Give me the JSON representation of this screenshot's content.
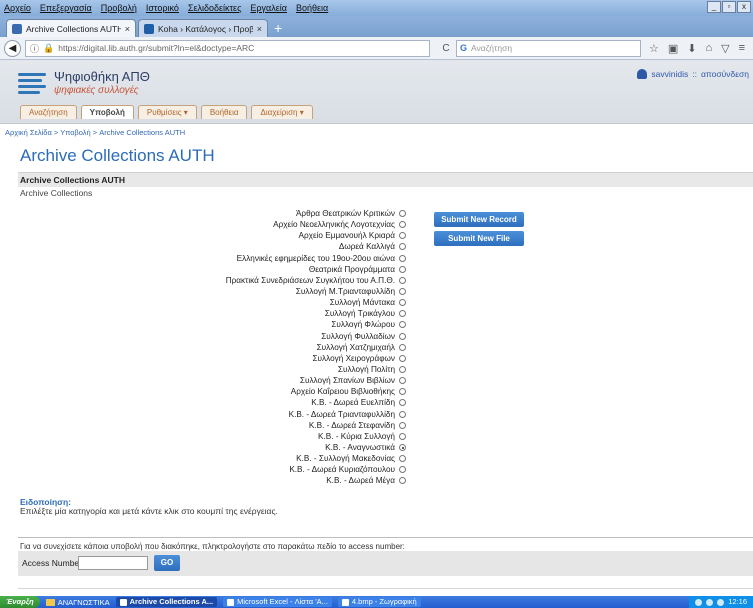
{
  "browser": {
    "menu": [
      "Αρχείο",
      "Επεξεργασία",
      "Προβολή",
      "Ιστορικό",
      "Σελιδοδείκτες",
      "Εργαλεία",
      "Βοήθεια"
    ],
    "window_buttons": [
      "_",
      "▫",
      "x"
    ],
    "tabs": [
      {
        "label": "Archive Collections AUTH - Αρ...",
        "close": "×"
      },
      {
        "label": "Koha › Κατάλογος › Προβολή ...",
        "close": "×"
      }
    ],
    "new_tab": "+",
    "url": "https://digital.lib.auth.gr/submit?ln=el&doctype=ARC",
    "url_host": "digital.lib.auth.gr",
    "search_placeholder": "Αναζήτηση"
  },
  "site": {
    "logo_line1": "Ψηφιοθήκη ΑΠΘ",
    "logo_line2": "ψηφιακές συλλογές",
    "user_name": "savvinidis",
    "logout": "αποσύνδεση",
    "nav": [
      {
        "label": "Αναζήτηση"
      },
      {
        "label": "Υποβολή"
      },
      {
        "label": "Ρυθμίσεις ▾"
      },
      {
        "label": "Βοήθεια"
      },
      {
        "label": "Διαχείριση ▾"
      }
    ],
    "breadcrumb": "Αρχική Σελίδα > Υποβολή > Archive Collections AUTH"
  },
  "main": {
    "title": "Archive Collections AUTH",
    "collection_header": "Archive Collections AUTH",
    "collection_sub": "Archive Collections",
    "options": [
      "Άρθρα Θεατρικών Κριτικών",
      "Αρχείο Νεοελληνικής Λογοτεχνίας",
      "Αρχείο Εμμανουήλ Κριαρά",
      "Δωρεά Καλλιγά",
      "Ελληνικές εφημερίδες του 19ου-20ου αιώνα",
      "Θεατρικά Προγράμματα",
      "Πρακτικά Συνεδριάσεων Συγκλήτου του Α.Π.Θ.",
      "Συλλογή Μ.Τριανταφυλλίδη",
      "Συλλογή Μάντακα",
      "Συλλογή Τρικάγλου",
      "Συλλογή Φλώρου",
      "Συλλογή Φυλλαδίων",
      "Συλλογή Χατζημιχαήλ",
      "Συλλογή Χειρογράφων",
      "Συλλογή Πολίτη",
      "Συλλογή Σπανίων Βιβλίων",
      "Αρχείο Καΐρειου Βιβλιοθήκης",
      "Κ.Β. - Δωρεά Ευελπίδη",
      "Κ.Β. - Δωρεά Τριανταφυλλίδη",
      "Κ.Β. - Δωρεά Στεφανίδη",
      "Κ.Β. - Κύρια Συλλογή",
      "Κ.Β. - Αναγνωστικά",
      "Κ.Β. - Συλλογή Μακεδονίας",
      "Κ.Β. - Δωρεά Κυριαζόπουλου",
      "Κ.Β. - Δωρεά Μέγα"
    ],
    "selected_option": "Κ.Β. - Αναγνωστικά",
    "submit_record": "Submit New Record",
    "submit_file": "Submit New File",
    "notice_title": "Ειδοποίηση:",
    "notice_text": "Επιλέξτε μία κατηγορία και μετά κάντε κλικ στο κουμπί της ενέργειας.",
    "access_hint": "Για να συνεχίσετε κάποια υποβολή που διακόπηκε, πληκτρολογήστε στο παρακάτω πεδίο το access number:",
    "access_label": "Access Number:",
    "access_value": "",
    "go": "GO"
  },
  "taskbar": {
    "start": "Έναρξη",
    "quick_folder": "ΑΝΑΓΝΩΣΤΙΚΑ",
    "tasks": [
      {
        "label": "Archive Collections A...",
        "active": true
      },
      {
        "label": "Microsoft Excel - Λίστα 'Α...",
        "active": false
      },
      {
        "label": "4.bmp - Ζωγραφική",
        "active": false
      }
    ],
    "clock": "12:16"
  },
  "colors": {
    "link_blue": "#2b6cb8",
    "button_blue": "#2e6fbe",
    "nav_tab_orange": "#b0652c"
  }
}
